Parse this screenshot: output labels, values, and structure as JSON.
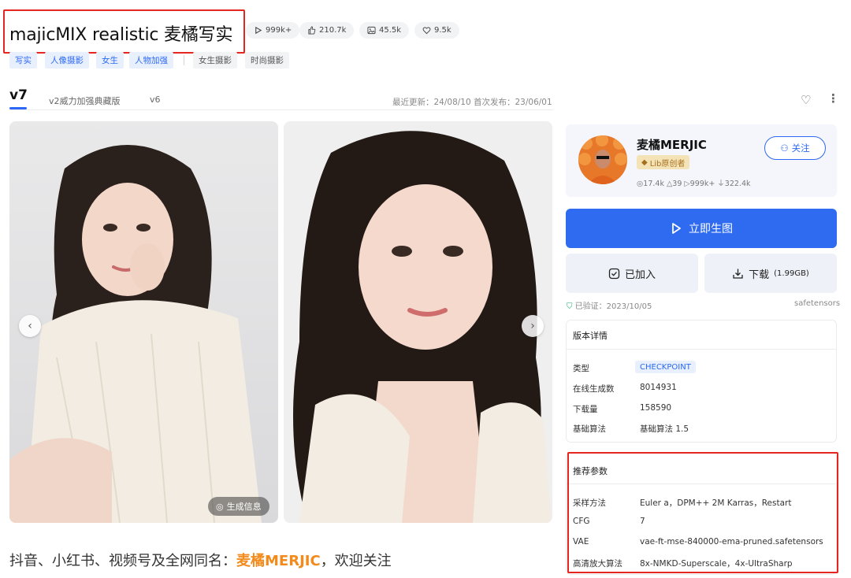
{
  "model": {
    "title": "majicMIX realistic 麦橘写实",
    "stats": [
      {
        "icon": "play-icon",
        "value": "999k+"
      },
      {
        "icon": "thumbs-up-icon",
        "value": "210.7k"
      },
      {
        "icon": "image-icon",
        "value": "45.5k"
      },
      {
        "icon": "heart-icon",
        "value": "9.5k"
      }
    ],
    "tags_blue": [
      "写实",
      "人像摄影",
      "女生",
      "人物加强"
    ],
    "tags_gray": [
      "女生摄影",
      "时尚摄影"
    ]
  },
  "versions": {
    "tabs": [
      "v7",
      "v2威力加强典藏版",
      "v6"
    ],
    "active": "v7",
    "update_info": "最近更新：24/08/10  首次发布：23/06/01"
  },
  "gallery": {
    "gen_info_label": "生成信息",
    "prev_icon": "chevron-left-icon",
    "next_icon": "chevron-right-icon"
  },
  "promo": {
    "prefix": "抖音、小红书、视频号及全网同名：",
    "name": "麦橘MERJIC",
    "suffix": "，欢迎关注"
  },
  "author": {
    "name": "麦橘MERJIC",
    "badge": "Lib原创者",
    "stats": "◎17.4k  △39  ▷999k+  ⏚322.4k",
    "follow_label": "关注"
  },
  "actions": {
    "generate_label": "立即生图",
    "added_label": "已加入",
    "download_label": "下载",
    "download_size": "(1.99GB)"
  },
  "verification": {
    "text": "已验证：2023/10/05",
    "format": "safetensors"
  },
  "version_details": {
    "heading": "版本详情",
    "rows": [
      {
        "label": "类型",
        "value": "CHECKPOINT"
      },
      {
        "label": "在线生成数",
        "value": "8014931"
      },
      {
        "label": "下载量",
        "value": "158590"
      },
      {
        "label": "基础算法",
        "value": "基础算法 1.5"
      }
    ]
  },
  "recommended_params": {
    "heading": "推荐参数",
    "rows": [
      {
        "label": "采样方法",
        "value": "Euler a，DPM++ 2M Karras，Restart"
      },
      {
        "label": "CFG",
        "value": "7"
      },
      {
        "label": "VAE",
        "value": "vae-ft-mse-840000-ema-pruned.safetensors"
      },
      {
        "label": "高清放大算法",
        "value": "8x-NMKD-Superscale，4x-UltraSharp"
      }
    ]
  },
  "colors": {
    "accent": "#2f6bf0",
    "highlight_box": "#e52620",
    "promo_name": "#f28a1c"
  }
}
